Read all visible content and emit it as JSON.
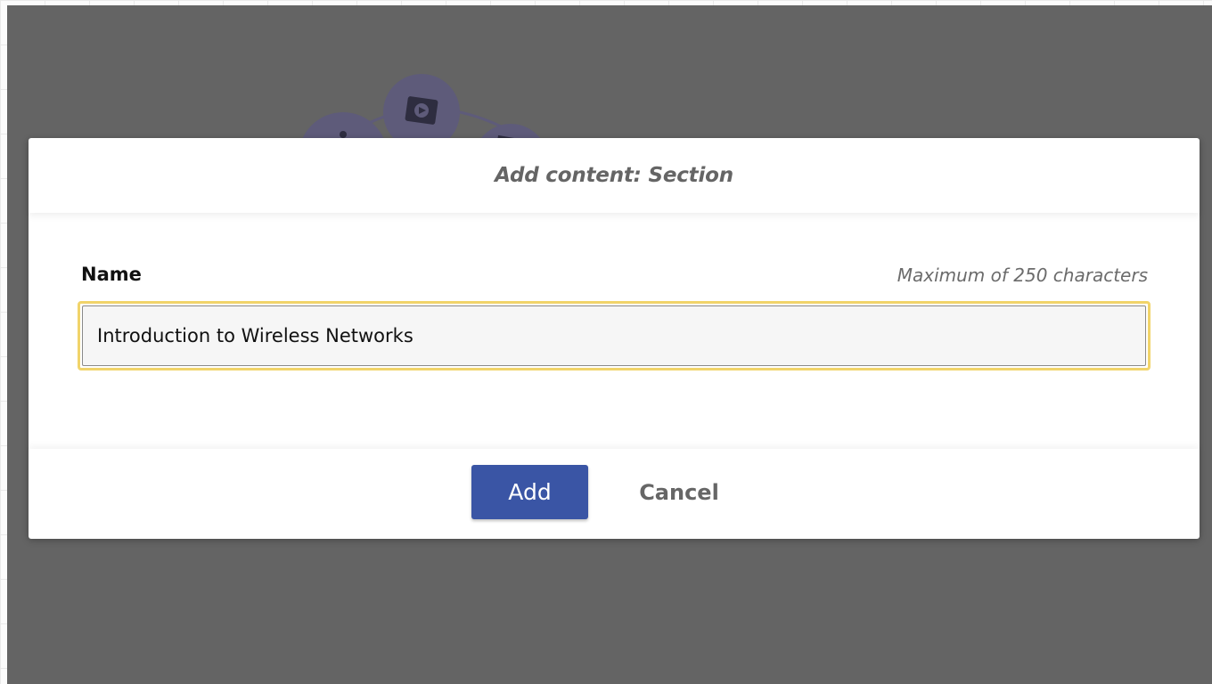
{
  "dialog": {
    "title": "Add content: Section"
  },
  "name_field": {
    "label": "Name",
    "hint": "Maximum of 250 characters",
    "value": "Introduction to Wireless Networks"
  },
  "actions": {
    "add_label": "Add",
    "cancel_label": "Cancel"
  },
  "colors": {
    "overlay": "#646464",
    "primary_button": "#3a55a5",
    "focus_ring": "#f1d46a",
    "illustration": "#5e5b7a"
  },
  "icons": [
    "video-icon",
    "dot-icon"
  ]
}
